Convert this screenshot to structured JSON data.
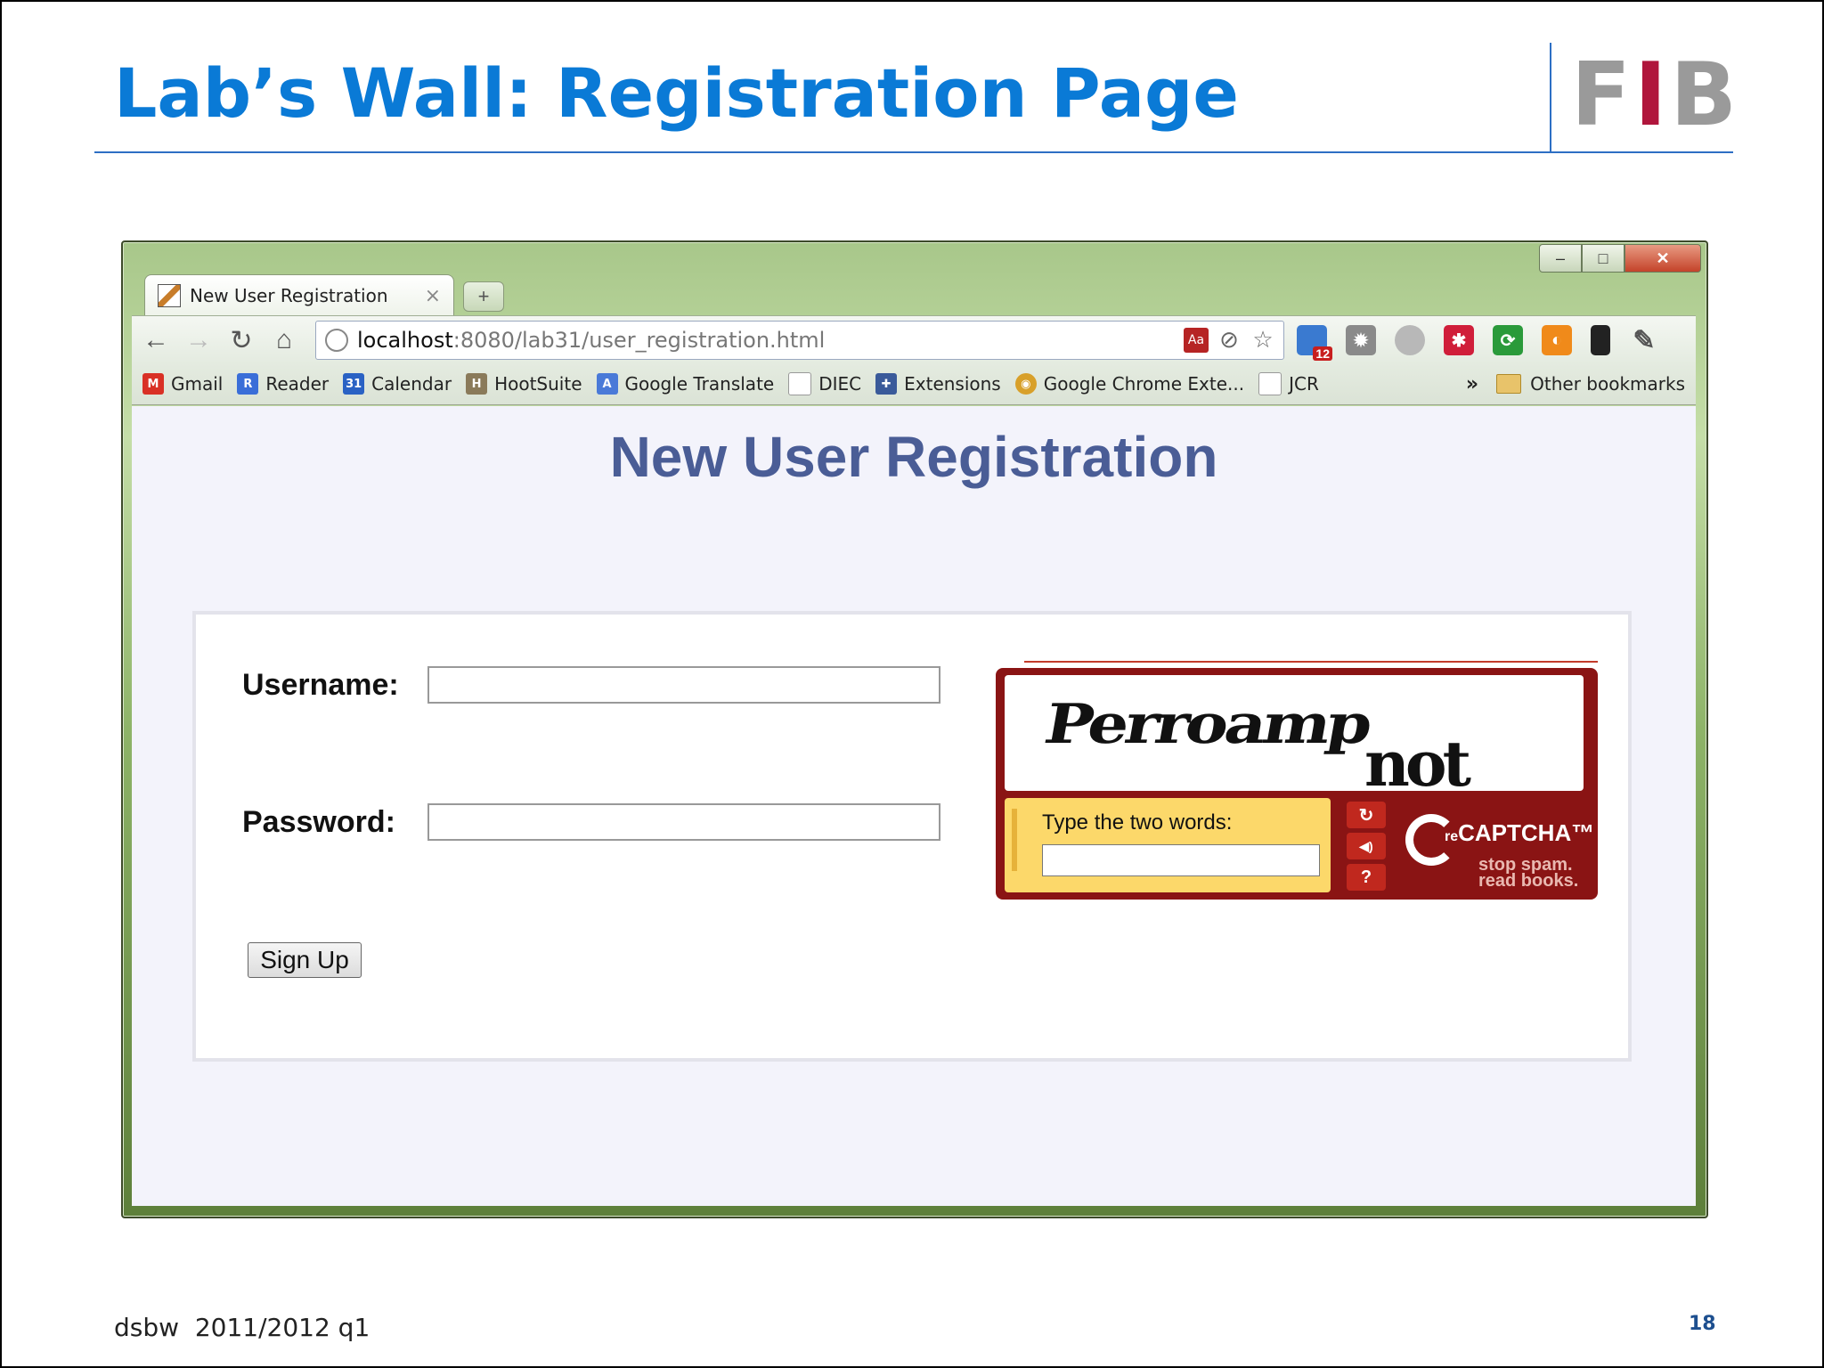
{
  "slide": {
    "title": "Lab’s Wall: Registration Page",
    "logo": {
      "text_prefix": "F",
      "text_highlight": "I",
      "text_suffix": "B"
    },
    "footer_left": "dsbw  2011/2012 q1",
    "page_number": "18"
  },
  "browser": {
    "tab": {
      "label": "New User Registration",
      "close": "×"
    },
    "new_tab_symbol": "+",
    "window_controls": {
      "minimize": "–",
      "maximize": "□",
      "close": "✕"
    },
    "address": {
      "host": "localhost",
      "path": ":8080/lab31/user_registration.html"
    },
    "extension_badge": "12",
    "bookmarks": [
      {
        "label": "Gmail",
        "icon": "gmail-icon",
        "color": "#d93025",
        "glyph": "M"
      },
      {
        "label": "Reader",
        "icon": "reader-icon",
        "color": "#3a6ed8",
        "glyph": "R"
      },
      {
        "label": "Calendar",
        "icon": "calendar-icon",
        "color": "#2a62c4",
        "glyph": "31"
      },
      {
        "label": "HootSuite",
        "icon": "hootsuite-icon",
        "color": "#8a7a5a",
        "glyph": "H"
      },
      {
        "label": "Google Translate",
        "icon": "translate-icon",
        "color": "#4a7ad8",
        "glyph": "A"
      },
      {
        "label": "DIEC",
        "icon": "page-icon",
        "color": "#bbbbbb",
        "glyph": ""
      },
      {
        "label": "Extensions",
        "icon": "puzzle-icon",
        "color": "#3a5a9a",
        "glyph": "✚"
      },
      {
        "label": "Google Chrome Exte...",
        "icon": "chrome-icon",
        "color": "#d8a02a",
        "glyph": "◉"
      },
      {
        "label": "JCR",
        "icon": "blank-page-icon",
        "color": "#dddddd",
        "glyph": ""
      }
    ],
    "bookmarks_overflow": "»",
    "other_bookmarks": "Other bookmarks"
  },
  "page": {
    "heading": "New User Registration",
    "form": {
      "username_label": "Username:",
      "username_value": "",
      "password_label": "Password:",
      "password_value": "",
      "submit_label": "Sign Up"
    },
    "recaptcha": {
      "word1": "Perroamp",
      "word2": "not",
      "prompt": "Type the two words:",
      "response_value": "",
      "controls": {
        "refresh": "↻",
        "audio": "◀)",
        "help": "?"
      },
      "brand_prefix": "re",
      "brand": "CAPTCHA™",
      "tagline1": "stop spam.",
      "tagline2": "read books."
    }
  },
  "colors": {
    "title_blue": "#0a7ad6",
    "heading_blue": "#4a5d96",
    "logo_red": "#b0163c",
    "recaptcha_red": "#8a1414",
    "recaptcha_yellow": "#fcd86a"
  }
}
